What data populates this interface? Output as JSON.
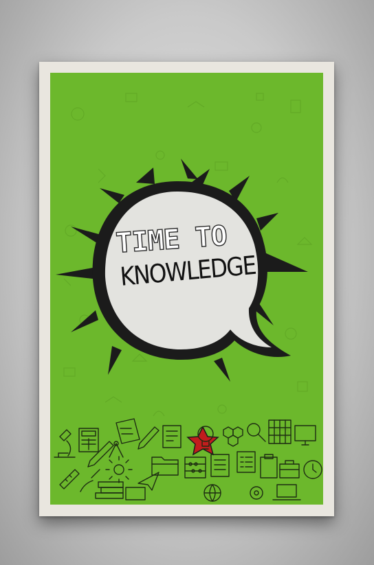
{
  "poster": {
    "headline_line_1": "TIME TO",
    "headline_line_2": "KNOWLEDGE"
  },
  "colors": {
    "background": "#6cb82c",
    "bubble_fill": "#e3e3df",
    "bubble_border": "#1b1b1b",
    "star": "#c21d1d",
    "frame": "#e9e6df",
    "icon_stroke": "#1d2b12"
  },
  "icons": [
    "microscope-icon",
    "calculator-icon",
    "book-icon",
    "pencil-icon",
    "document-icon",
    "lightbulb-icon",
    "hexagon-molecule-icon",
    "magnifier-icon",
    "bookshelf-icon",
    "monitor-icon",
    "ruler-icon",
    "compass-icon",
    "paper-plane-icon",
    "folder-icon",
    "abacus-icon",
    "notebook-icon",
    "briefcase-icon",
    "clock-icon",
    "globe-icon",
    "paintbrush-icon"
  ]
}
